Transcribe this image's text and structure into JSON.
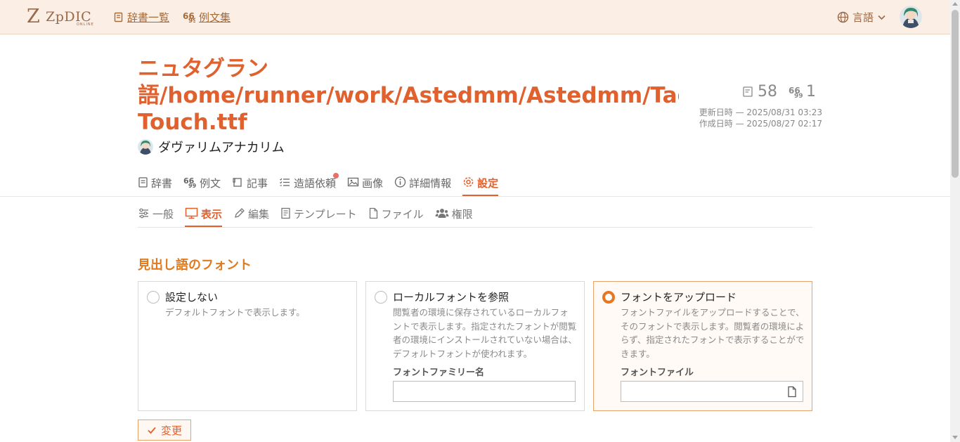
{
  "header": {
    "logo_text": "ZpDIC",
    "logo_sub": "ONLINE",
    "nav": [
      {
        "label": "辞書一覧",
        "icon": "dictionary-list-icon"
      },
      {
        "label": "例文集",
        "icon": "quote-icon"
      }
    ],
    "language_label": "言語"
  },
  "dictionary": {
    "title_lines": [
      "ニュタグラン",
      "語/home/runner/work/Astedmm/Astedmm/Tagele",
      "Touch.ttf"
    ],
    "owner_name": "ダヴァリムアナカリム",
    "word_count": "58",
    "example_count": "1",
    "updated": "更新日時 — 2025/08/31 03:23",
    "created": "作成日時 — 2025/08/27 02:17"
  },
  "tabs": [
    {
      "label": "辞書",
      "icon": "dictionary-icon",
      "active": false
    },
    {
      "label": "例文",
      "icon": "quote-icon",
      "active": false
    },
    {
      "label": "記事",
      "icon": "article-icon",
      "active": false
    },
    {
      "label": "造語依頼",
      "icon": "request-list-icon",
      "active": false,
      "has_notification": true
    },
    {
      "label": "画像",
      "icon": "image-icon",
      "active": false
    },
    {
      "label": "詳細情報",
      "icon": "info-icon",
      "active": false
    },
    {
      "label": "設定",
      "icon": "gear-icon",
      "active": true
    }
  ],
  "subtabs": [
    {
      "label": "一般",
      "icon": "sliders-icon",
      "active": false
    },
    {
      "label": "表示",
      "icon": "monitor-icon",
      "active": true
    },
    {
      "label": "編集",
      "icon": "pencil-icon",
      "active": false
    },
    {
      "label": "テンプレート",
      "icon": "template-icon",
      "active": false
    },
    {
      "label": "ファイル",
      "icon": "file-icon",
      "active": false
    },
    {
      "label": "権限",
      "icon": "users-icon",
      "active": false
    }
  ],
  "font_section": {
    "title": "見出し語のフォント",
    "options": [
      {
        "title": "設定しない",
        "description": "デフォルトフォントで表示します。",
        "selected": false
      },
      {
        "title": "ローカルフォントを参照",
        "description": "閲覧者の環境に保存されているローカルフォントで表示します。指定されたフォントが閲覧者の環境にインストールされていない場合は、デフォルトフォントが使われます。",
        "field_label": "フォントファミリー名",
        "field_value": "",
        "selected": false
      },
      {
        "title": "フォントをアップロード",
        "description": "フォントファイルをアップロードすることで、そのフォントで表示します。閲覧者の環境によらず、指定されたフォントで表示することができます。",
        "field_label": "フォントファイル",
        "field_value": "",
        "selected": true
      }
    ],
    "submit_label": "変更"
  },
  "colors": {
    "accent": "#e0602e",
    "section_title": "#e07a1e",
    "header_bg": "#fbeee5"
  }
}
